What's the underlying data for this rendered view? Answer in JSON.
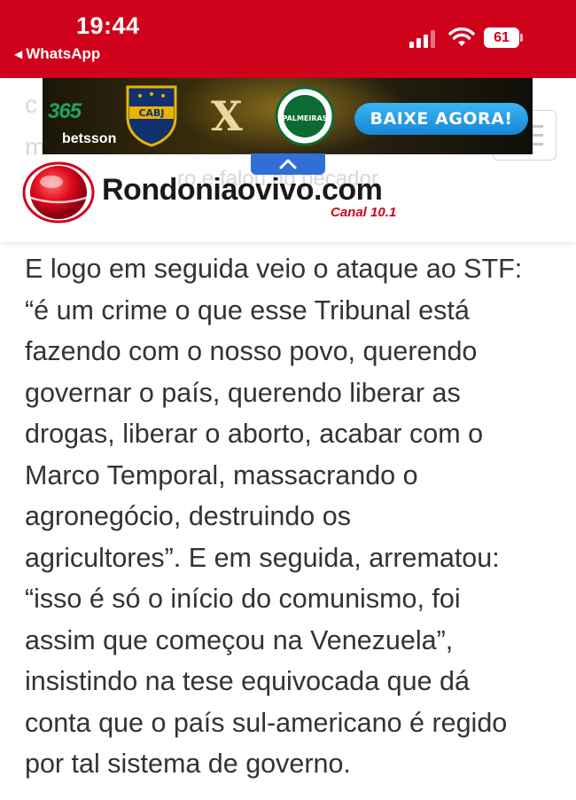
{
  "status_bar": {
    "time": "19:44",
    "back_app": "WhatsApp",
    "battery": "61",
    "background_color": "#d0021b"
  },
  "header": {
    "ghost_lines": [
      "c",
      "m",
      "ro e falou no pecador"
    ],
    "menu_icon": "hamburger-menu-icon"
  },
  "ad": {
    "brand_top": "365",
    "brand_bottom": "betsson",
    "team_home": "CABJ",
    "versus": "X",
    "team_away": "PALMEIRAS",
    "cta": "BAIXE AGORA!",
    "collapse_icon": "chevron-up-icon"
  },
  "logo": {
    "name": "Rondoniaovivo.com",
    "subtitle": "Canal 10.1",
    "accent_color": "#d0021b"
  },
  "article": {
    "lines": [
      "E logo em seguida veio o ataque ao STF:",
      "“é um crime o que esse Tribunal está",
      "fazendo com o nosso povo, querendo",
      "governar o país, querendo liberar as",
      "drogas, liberar o aborto, acabar com o",
      "Marco Temporal, massacrando o",
      "agronegócio, destruindo os",
      "agricultores”. E em seguida, arrematou:",
      "“isso é só o início do comunismo, foi",
      "assim que começou na Venezuela”,",
      "insistindo na tese equivocada que dá",
      "conta que o país sul-americano é regido",
      "por tal sistema de governo."
    ]
  }
}
